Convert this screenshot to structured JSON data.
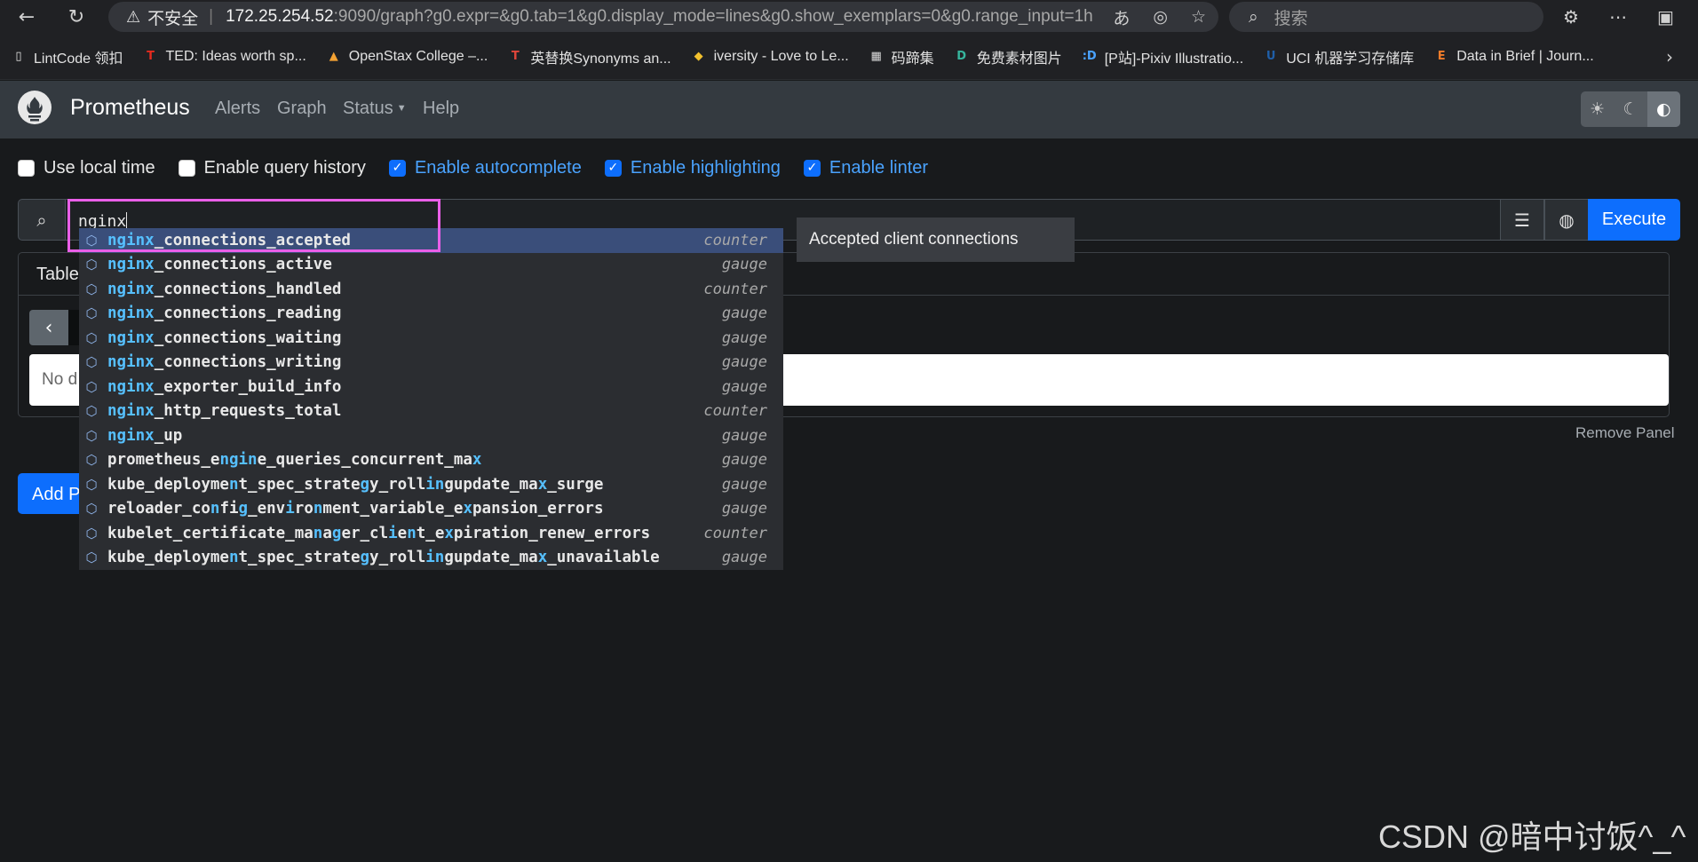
{
  "browser": {
    "insecure_label": "不安全",
    "url_host": "172.25.254.52",
    "url_rest": ":9090/graph?g0.expr=&g0.tab=1&g0.display_mode=lines&g0.show_exemplars=0&g0.range_input=1h",
    "search_placeholder": "搜索",
    "bookmarks": [
      {
        "label": "LintCode 领扣",
        "icon": "page-icon",
        "color": "#e2e2e2"
      },
      {
        "label": "TED: Ideas worth sp...",
        "icon": "ted-icon",
        "color": "#e62b1e"
      },
      {
        "label": "OpenStax College –...",
        "icon": "openstax-icon",
        "color": "#f4a233"
      },
      {
        "label": "英替换Synonyms an...",
        "icon": "synonyms-icon",
        "color": "#e0463a"
      },
      {
        "label": "iversity - Love to Le...",
        "icon": "iversity-icon",
        "color": "#f2c12e"
      },
      {
        "label": "码蹄集",
        "icon": "matiji-icon",
        "color": "#dcdcdc"
      },
      {
        "label": "免费素材图片",
        "icon": "sucai-icon",
        "color": "#36b59d"
      },
      {
        "label": "[P站]-Pixiv Illustratio...",
        "icon": "pixiv-icon",
        "color": "#4aa3ff"
      },
      {
        "label": "UCI 机器学习存储库",
        "icon": "uci-icon",
        "color": "#1f5fa8"
      },
      {
        "label": "Data in Brief | Journ...",
        "icon": "elsevier-icon",
        "color": "#f07c2a"
      }
    ]
  },
  "nav": {
    "brand": "Prometheus",
    "links": [
      "Alerts",
      "Graph",
      "Status",
      "Help"
    ]
  },
  "options": [
    {
      "label": "Use local time",
      "checked": false
    },
    {
      "label": "Enable query history",
      "checked": false
    },
    {
      "label": "Enable autocomplete",
      "checked": true
    },
    {
      "label": "Enable highlighting",
      "checked": true
    },
    {
      "label": "Enable linter",
      "checked": true
    }
  ],
  "query": {
    "value": "nginx",
    "execute_label": "Execute"
  },
  "panel": {
    "tab_label": "Table",
    "no_data_text": "No d",
    "remove_label": "Remove Panel",
    "add_panel_label": "Add P"
  },
  "autocomplete": {
    "info": "Accepted client connections",
    "items": [
      {
        "name": "nginx_connections_accepted",
        "type": "counter"
      },
      {
        "name": "nginx_connections_active",
        "type": "gauge"
      },
      {
        "name": "nginx_connections_handled",
        "type": "counter"
      },
      {
        "name": "nginx_connections_reading",
        "type": "gauge"
      },
      {
        "name": "nginx_connections_waiting",
        "type": "gauge"
      },
      {
        "name": "nginx_connections_writing",
        "type": "gauge"
      },
      {
        "name": "nginx_exporter_build_info",
        "type": "gauge"
      },
      {
        "name": "nginx_http_requests_total",
        "type": "counter"
      },
      {
        "name": "nginx_up",
        "type": "gauge"
      },
      {
        "name": "prometheus_engine_queries_concurrent_max",
        "type": "gauge"
      },
      {
        "name": "kube_deployment_spec_strategy_rollingupdate_max_surge",
        "type": "gauge"
      },
      {
        "name": "reloader_config_environment_variable_expansion_errors",
        "type": "gauge"
      },
      {
        "name": "kubelet_certificate_manager_client_expiration_renew_errors",
        "type": "counter"
      },
      {
        "name": "kube_deployment_spec_strategy_rollingupdate_max_unavailable",
        "type": "gauge"
      }
    ]
  },
  "watermark": "CSDN @暗中讨饭^_^"
}
